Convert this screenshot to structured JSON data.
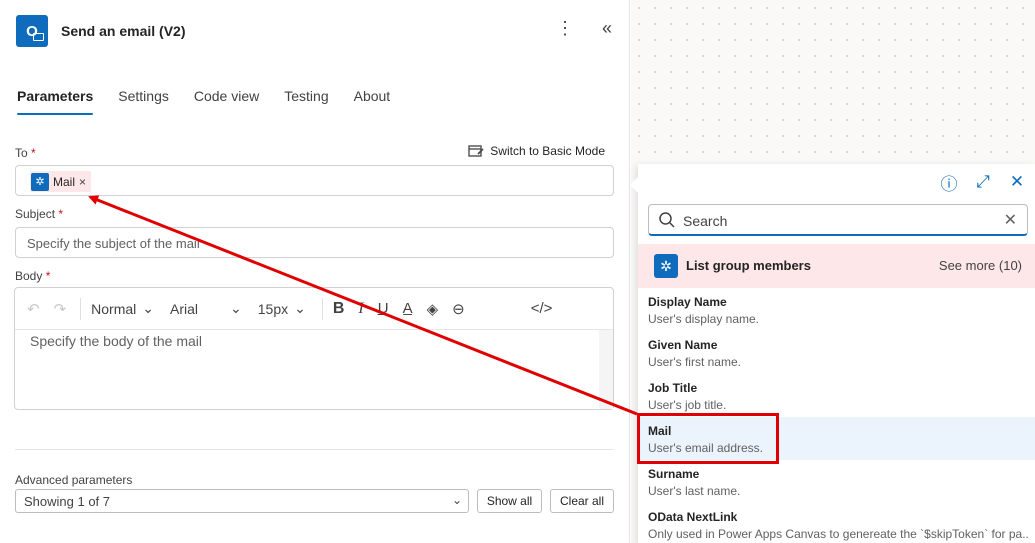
{
  "header": {
    "title": "Send an email (V2)",
    "app_icon_letter": "O"
  },
  "tabs": [
    {
      "label": "Parameters"
    },
    {
      "label": "Settings"
    },
    {
      "label": "Code view"
    },
    {
      "label": "Testing"
    },
    {
      "label": "About"
    }
  ],
  "to": {
    "label": "To",
    "required_mark": "*",
    "switch_label": "Switch to Basic Mode",
    "token_label": "Mail",
    "token_remove": "×"
  },
  "subject": {
    "label": "Subject",
    "required_mark": "*",
    "placeholder": "Specify the subject of the mail"
  },
  "body": {
    "label": "Body",
    "required_mark": "*",
    "style_value": "Normal",
    "font_value": "Arial",
    "size_value": "15px",
    "placeholder": "Specify the body of the mail"
  },
  "advanced": {
    "label": "Advanced parameters",
    "select_value": "Showing 1 of 7",
    "show_all": "Show all",
    "clear_all": "Clear all"
  },
  "dynamic_content": {
    "search_placeholder": "Search",
    "group_title": "List group members",
    "see_more": "See more (10)",
    "items": [
      {
        "title": "Display Name",
        "desc": "User's display name."
      },
      {
        "title": "Given Name",
        "desc": "User's first name."
      },
      {
        "title": "Job Title",
        "desc": "User's job title."
      },
      {
        "title": "Mail",
        "desc": "User's email address."
      },
      {
        "title": "Surname",
        "desc": "User's last name."
      },
      {
        "title": "OData NextLink",
        "desc": "Only used in Power Apps Canvas to genereate the `$skipToken` for pa..."
      }
    ]
  },
  "colors": {
    "accent": "#0f6cbd",
    "token_bg": "#fde7e9",
    "annotation": "#e00000",
    "required": "#c50f1f"
  }
}
